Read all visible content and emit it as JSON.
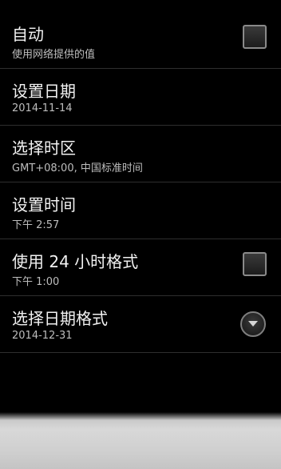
{
  "settings": [
    {
      "title": "自动",
      "summary": "使用网络提供的值",
      "control": "checkbox",
      "checked": false
    },
    {
      "title": "设置日期",
      "summary": "2014-11-14",
      "control": "none"
    },
    {
      "title": "选择时区",
      "summary": "GMT+08:00, 中国标准时间",
      "control": "none"
    },
    {
      "title": "设置时间",
      "summary": "下午 2:57",
      "control": "none"
    },
    {
      "title": "使用 24 小时格式",
      "summary": "下午 1:00",
      "control": "checkbox",
      "checked": false
    },
    {
      "title": "选择日期格式",
      "summary": "2014-12-31",
      "control": "dropdown",
      "icon": "chevron-down-icon"
    }
  ]
}
